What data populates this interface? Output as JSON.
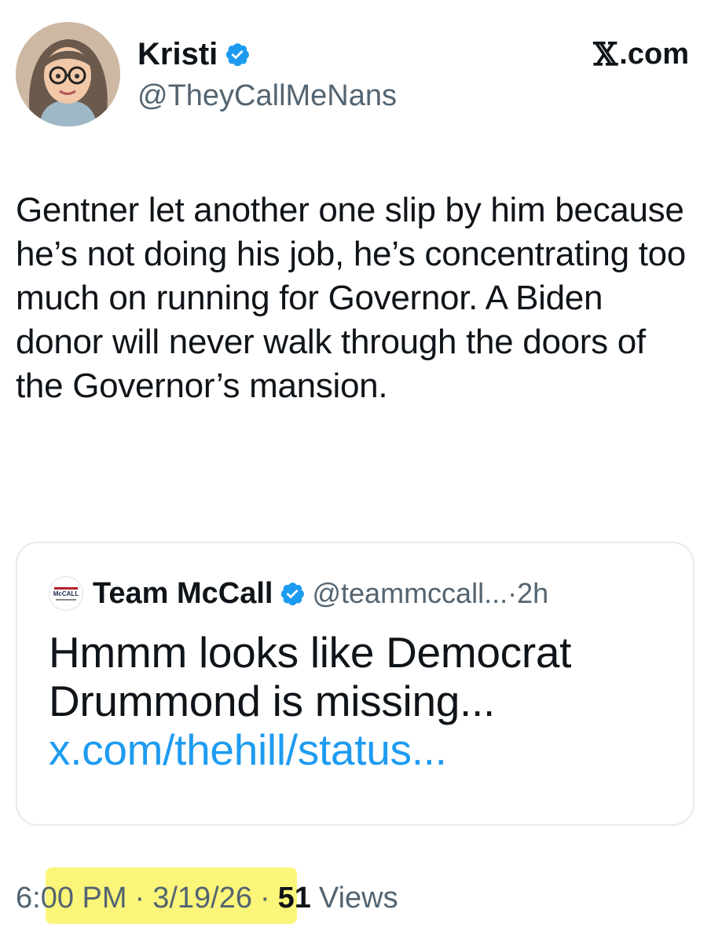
{
  "author": {
    "name": "Kristi",
    "handle": "@TheyCallMeNans",
    "verified": true,
    "avatar_icon": "cartoon-avatar-woman-glasses"
  },
  "brand": {
    "label": ".com",
    "mark": "𝕏"
  },
  "tweet": {
    "text": "Gentner let another one slip by him because he’s not doing his job, he’s concentrating too much on running for Governor. A Biden donor will never walk through the doors of the Governor’s mansion."
  },
  "quoted": {
    "name": "Team McCall",
    "handle": "@teammccall...",
    "separator": "·",
    "time": "2h",
    "text": "Hmmm looks like Democrat Drummond is missing...",
    "link": "x.com/thehill/status...",
    "logo_text": "McCALL"
  },
  "footer": {
    "time": "6:00 PM",
    "sep1": "·",
    "date": "3/19/26",
    "sep2": "·",
    "views_count": "51",
    "views_label": "Views"
  },
  "colors": {
    "text": "#0f1419",
    "muted": "#536471",
    "link": "#1d9bf0",
    "verified": "#1d9bf0",
    "highlight": "#fbf57a"
  }
}
